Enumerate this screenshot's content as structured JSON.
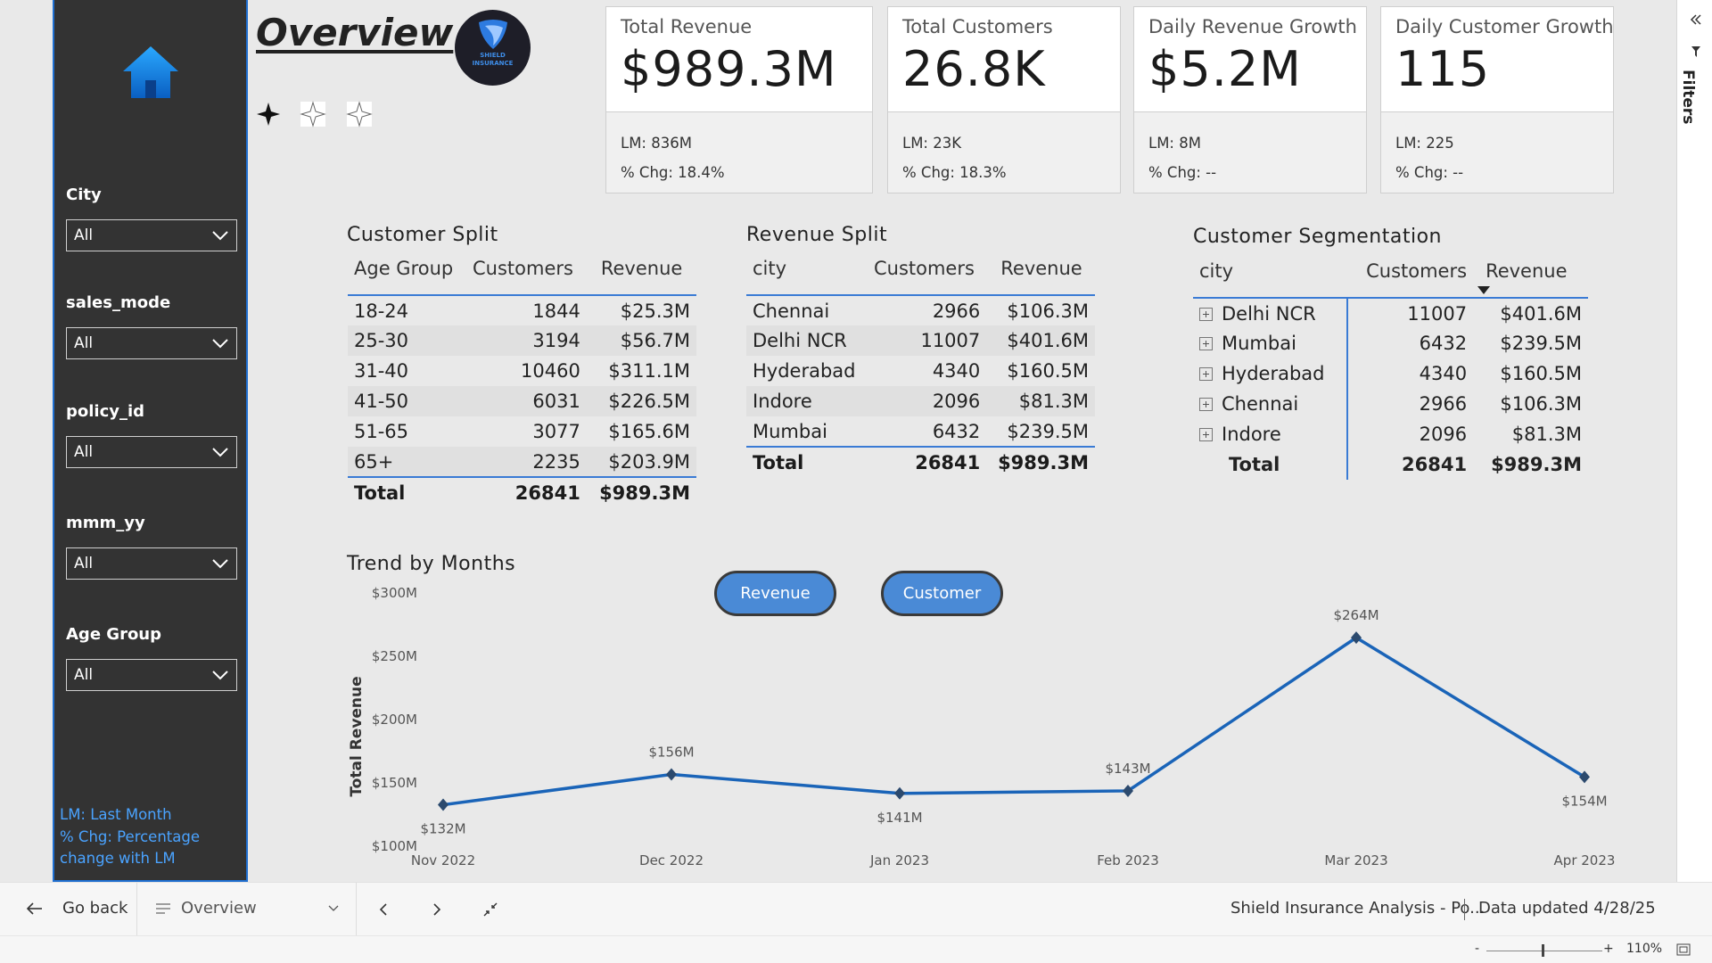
{
  "header": {
    "title": "Overview",
    "logo_text_1": "SHIELD",
    "logo_text_2": "INSURANCE"
  },
  "filters": [
    {
      "label": "City",
      "value": "All"
    },
    {
      "label": "sales_mode",
      "value": "All"
    },
    {
      "label": "policy_id",
      "value": "All"
    },
    {
      "label": "mmm_yy",
      "value": "All"
    },
    {
      "label": "Age Group",
      "value": "All"
    }
  ],
  "legend_note": {
    "line1": "LM: Last Month",
    "line2": "% Chg: Percentage",
    "line3": "change with LM"
  },
  "kpis": [
    {
      "title": "Total Revenue",
      "value": "$989.3M",
      "lm": "LM: 836M",
      "chg": "% Chg: 18.4%"
    },
    {
      "title": "Total Customers",
      "value": "26.8K",
      "lm": "LM: 23K",
      "chg": "% Chg: 18.3%"
    },
    {
      "title": "Daily Revenue Growth",
      "value": "$5.2M",
      "lm": "LM: 8M",
      "chg": "% Chg: --"
    },
    {
      "title": "Daily Customer Growth",
      "value": "115",
      "lm": "LM: 225",
      "chg": "% Chg: --"
    }
  ],
  "customer_split": {
    "title": "Customer Split",
    "headers": [
      "Age Group",
      "Customers",
      "Revenue"
    ],
    "rows": [
      [
        "18-24",
        "1844",
        "$25.3M"
      ],
      [
        "25-30",
        "3194",
        "$56.7M"
      ],
      [
        "31-40",
        "10460",
        "$311.1M"
      ],
      [
        "41-50",
        "6031",
        "$226.5M"
      ],
      [
        "51-65",
        "3077",
        "$165.6M"
      ],
      [
        "65+",
        "2235",
        "$203.9M"
      ]
    ],
    "total": [
      "Total",
      "26841",
      "$989.3M"
    ]
  },
  "revenue_split": {
    "title": "Revenue Split",
    "headers": [
      "city",
      "Customers",
      "Revenue"
    ],
    "rows": [
      [
        "Chennai",
        "2966",
        "$106.3M"
      ],
      [
        "Delhi NCR",
        "11007",
        "$401.6M"
      ],
      [
        "Hyderabad",
        "4340",
        "$160.5M"
      ],
      [
        "Indore",
        "2096",
        "$81.3M"
      ],
      [
        "Mumbai",
        "6432",
        "$239.5M"
      ]
    ],
    "total": [
      "Total",
      "26841",
      "$989.3M"
    ]
  },
  "customer_segmentation": {
    "title": "Customer Segmentation",
    "headers": [
      "city",
      "Customers",
      "Revenue"
    ],
    "rows": [
      [
        "Delhi NCR",
        "11007",
        "$401.6M"
      ],
      [
        "Mumbai",
        "6432",
        "$239.5M"
      ],
      [
        "Hyderabad",
        "4340",
        "$160.5M"
      ],
      [
        "Chennai",
        "2966",
        "$106.3M"
      ],
      [
        "Indore",
        "2096",
        "$81.3M"
      ]
    ],
    "total": [
      "Total",
      "26841",
      "$989.3M"
    ]
  },
  "trend": {
    "title": "Trend by Months",
    "toggle_revenue": "Revenue",
    "toggle_customer": "Customer"
  },
  "chart_data": {
    "type": "line",
    "title": "Trend by Months",
    "ylabel": "Total Revenue",
    "xlabel": "",
    "categories": [
      "Nov 2022",
      "Dec 2022",
      "Jan 2023",
      "Feb 2023",
      "Mar 2023",
      "Apr 2023"
    ],
    "series": [
      {
        "values": [
          132,
          156,
          141,
          143,
          264,
          154
        ],
        "labels": [
          "$132M",
          "$156M",
          "$141M",
          "$143M",
          "$264M",
          "$154M"
        ]
      }
    ],
    "ylim": [
      100,
      300
    ],
    "yticks": [
      100,
      150,
      200,
      250,
      300
    ],
    "ytick_labels": [
      "$100M",
      "$150M",
      "$200M",
      "$250M",
      "$300M"
    ],
    "color": "#1a64b8",
    "grid": false
  },
  "bottom": {
    "go_back": "Go back",
    "page": "Overview",
    "report_name": "Shield Insurance Analysis - Po...",
    "data_updated": "Data updated 4/28/25",
    "zoom": "110%",
    "zoom_minus": "-",
    "zoom_plus": "+"
  },
  "filters_pane": {
    "label": "Filters"
  }
}
